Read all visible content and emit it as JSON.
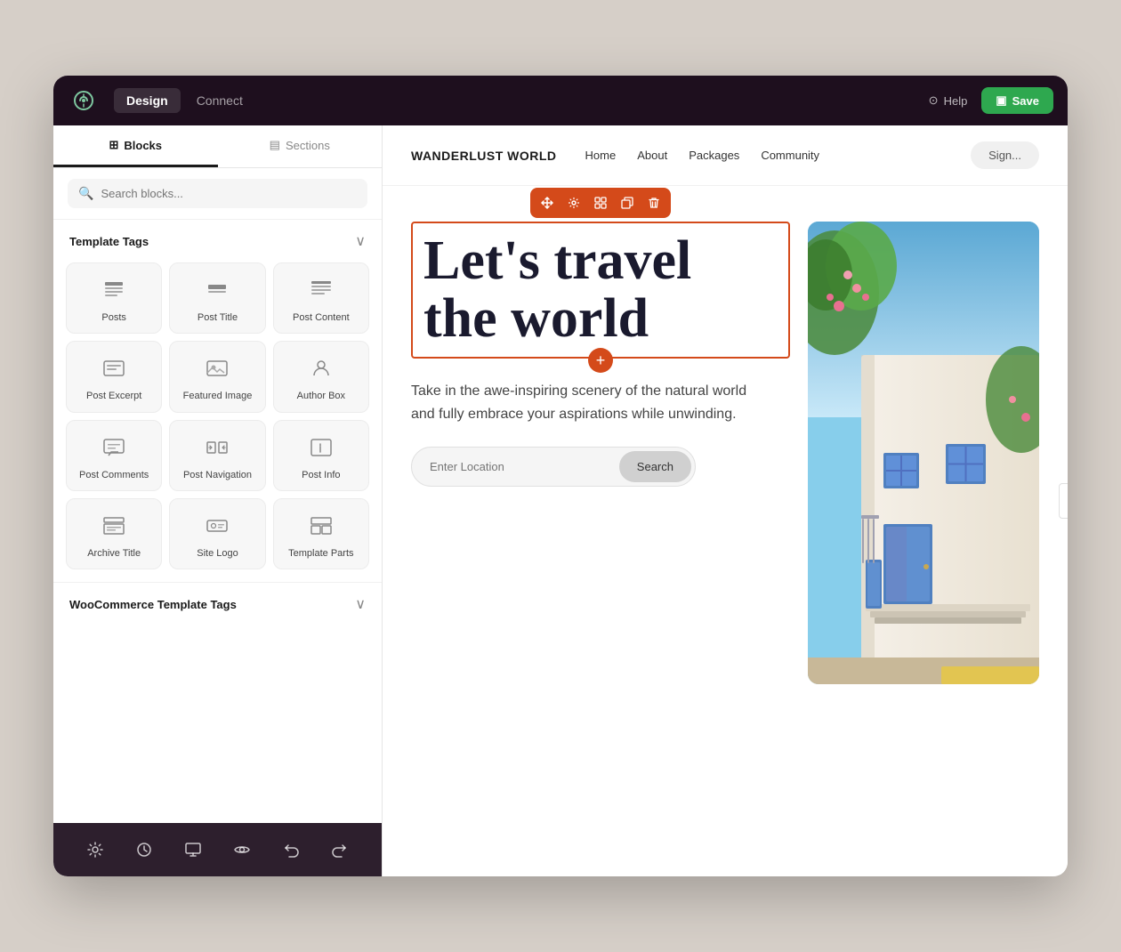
{
  "topbar": {
    "design_label": "Design",
    "connect_label": "Connect",
    "help_label": "Help",
    "save_label": "Save"
  },
  "sidebar": {
    "tabs": [
      {
        "label": "Blocks",
        "id": "blocks",
        "active": true
      },
      {
        "label": "Sections",
        "id": "sections",
        "active": false
      }
    ],
    "search_placeholder": "Search blocks...",
    "template_tags_section": "Template Tags",
    "blocks": [
      {
        "label": "Posts",
        "icon": "posts"
      },
      {
        "label": "Post Title",
        "icon": "post-title"
      },
      {
        "label": "Post Content",
        "icon": "post-content"
      },
      {
        "label": "Post Excerpt",
        "icon": "post-excerpt"
      },
      {
        "label": "Featured Image",
        "icon": "featured-image"
      },
      {
        "label": "Author Box",
        "icon": "author-box"
      },
      {
        "label": "Post Comments",
        "icon": "post-comments"
      },
      {
        "label": "Post Navigation",
        "icon": "post-navigation"
      },
      {
        "label": "Post Info",
        "icon": "post-info"
      },
      {
        "label": "Archive Title",
        "icon": "archive-title"
      },
      {
        "label": "Site Logo",
        "icon": "site-logo"
      },
      {
        "label": "Template Parts",
        "icon": "template-parts"
      }
    ],
    "woocommerce_section": "WooCommerce Template Tags",
    "bottom_icons": [
      "settings",
      "history",
      "desktop",
      "visibility",
      "undo",
      "redo"
    ]
  },
  "canvas": {
    "site_logo": "WANDERLUST WORLD",
    "nav_links": [
      "Home",
      "About",
      "Packages",
      "Community"
    ],
    "signin_label": "Sign...",
    "hero_title": "Let's travel the world",
    "hero_subtitle": "Take in the awe-inspiring scenery of the natural world and fully embrace your aspirations while unwinding.",
    "search_placeholder": "Enter Location",
    "search_btn": "Search"
  },
  "block_toolbar": {
    "buttons": [
      "move",
      "settings",
      "layout",
      "duplicate",
      "delete"
    ]
  }
}
